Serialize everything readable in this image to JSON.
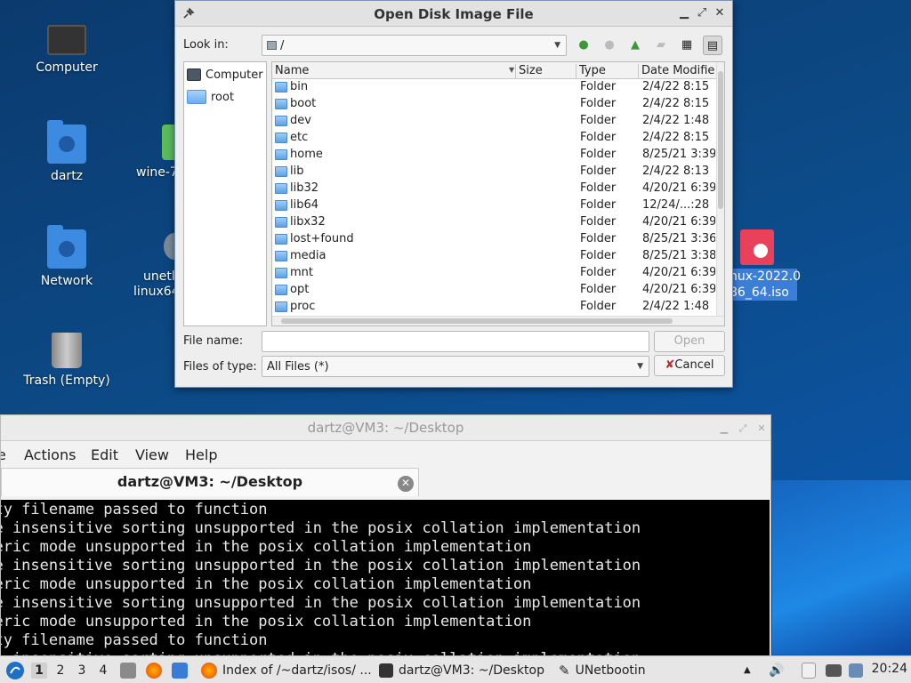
{
  "desktop": {
    "icons": {
      "computer": "Computer",
      "home": "dartz",
      "network": "Network",
      "trash": "Trash (Empty)",
      "wine_partial": "wine-7",
      "unet_partial_1": "unetl",
      "unet_partial_2": "linux64",
      "iso_partial_1": "nux-2022.0",
      "iso_partial_2": "86_64.iso"
    }
  },
  "dialog": {
    "title": "Open Disk Image File",
    "look_in_label": "Look in:",
    "look_in_value": "/",
    "sidebar": [
      "Computer",
      "root"
    ],
    "columns": {
      "name": "Name",
      "size": "Size",
      "type": "Type",
      "date": "Date Modifie"
    },
    "files": [
      {
        "name": "bin",
        "type": "Folder",
        "date": "2/4/22 8:15"
      },
      {
        "name": "boot",
        "type": "Folder",
        "date": "2/4/22 8:15"
      },
      {
        "name": "dev",
        "type": "Folder",
        "date": "2/4/22 1:48"
      },
      {
        "name": "etc",
        "type": "Folder",
        "date": "2/4/22 8:15"
      },
      {
        "name": "home",
        "type": "Folder",
        "date": "8/25/21 3:39"
      },
      {
        "name": "lib",
        "type": "Folder",
        "date": "2/4/22 8:13"
      },
      {
        "name": "lib32",
        "type": "Folder",
        "date": "4/20/21 6:39"
      },
      {
        "name": "lib64",
        "type": "Folder",
        "date": "12/24/...:28"
      },
      {
        "name": "libx32",
        "type": "Folder",
        "date": "4/20/21 6:39"
      },
      {
        "name": "lost+found",
        "type": "Folder",
        "date": "8/25/21 3:36"
      },
      {
        "name": "media",
        "type": "Folder",
        "date": "8/25/21 3:38"
      },
      {
        "name": "mnt",
        "type": "Folder",
        "date": "4/20/21 6:39"
      },
      {
        "name": "opt",
        "type": "Folder",
        "date": "4/20/21 6:39"
      },
      {
        "name": "proc",
        "type": "Folder",
        "date": "2/4/22 1:48"
      }
    ],
    "file_name_label": "File name:",
    "file_name_value": "",
    "files_of_type_label": "Files of type:",
    "files_of_type_value": "All Files (*)",
    "open_button": "Open",
    "cancel_button": "Cancel"
  },
  "terminal": {
    "title": "dartz@VM3: ~/Desktop",
    "menu": [
      "e",
      "Actions",
      "Edit",
      "View",
      "Help"
    ],
    "tab_label": "dartz@VM3: ~/Desktop",
    "lines": [
      "mpty filename passed to function",
      "ase insensitive sorting unsupported in the posix collation implementation",
      "umeric mode unsupported in the posix collation implementation",
      "ase insensitive sorting unsupported in the posix collation implementation",
      "umeric mode unsupported in the posix collation implementation",
      "ase insensitive sorting unsupported in the posix collation implementation",
      "umeric mode unsupported in the posix collation implementation",
      "mpty filename passed to function",
      "ase insensitive sorting unsupported in the posix collation implementation"
    ]
  },
  "taskbar": {
    "workspaces": [
      "1",
      "2",
      "3",
      "4"
    ],
    "tasks": [
      {
        "label": "Index of /~dartz/isos/ ..."
      },
      {
        "label": "dartz@VM3: ~/Desktop"
      },
      {
        "label": "UNetbootin"
      }
    ],
    "clock": "20:24"
  }
}
